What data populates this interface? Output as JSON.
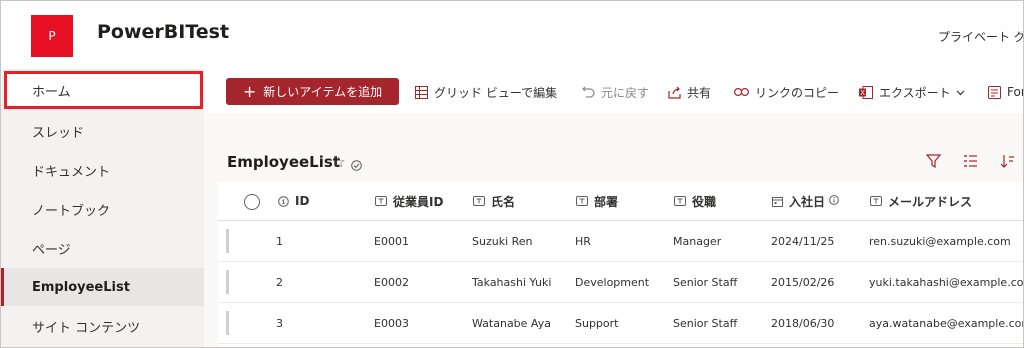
{
  "site": {
    "logo_letter": "P",
    "title": "PowerBITest",
    "privacy": "プライベート グ"
  },
  "sidebar": {
    "items": [
      {
        "label": "ホーム"
      },
      {
        "label": "スレッド"
      },
      {
        "label": "ドキュメント"
      },
      {
        "label": "ノートブック"
      },
      {
        "label": "ページ"
      },
      {
        "label": "EmployeeList"
      },
      {
        "label": "サイト コンテンツ"
      }
    ]
  },
  "toolbar": {
    "new_item": "新しいアイテムを追加",
    "grid_view": "グリッド ビューで編集",
    "undo": "元に戻す",
    "share": "共有",
    "copy_link": "リンクのコピー",
    "export": "エクスポート",
    "forms": "For"
  },
  "list": {
    "title": "EmployeeList",
    "columns": [
      "ID",
      "従業員ID",
      "氏名",
      "部署",
      "役職",
      "入社日",
      "メールアドレス"
    ],
    "rows": [
      {
        "id": "1",
        "emp": "E0001",
        "name": "Suzuki Ren",
        "dept": "HR",
        "role": "Manager",
        "date": "2024/11/25",
        "email": "ren.suzuki@example.com"
      },
      {
        "id": "2",
        "emp": "E0002",
        "name": "Takahashi Yuki",
        "dept": "Development",
        "role": "Senior Staff",
        "date": "2015/02/26",
        "email": "yuki.takahashi@example.com"
      },
      {
        "id": "3",
        "emp": "E0003",
        "name": "Watanabe Aya",
        "dept": "Support",
        "role": "Senior Staff",
        "date": "2018/06/30",
        "email": "aya.watanabe@example.com"
      }
    ]
  },
  "colors": {
    "accent": "#a4262c",
    "logo": "#e81123",
    "highlight": "#e8202a"
  }
}
